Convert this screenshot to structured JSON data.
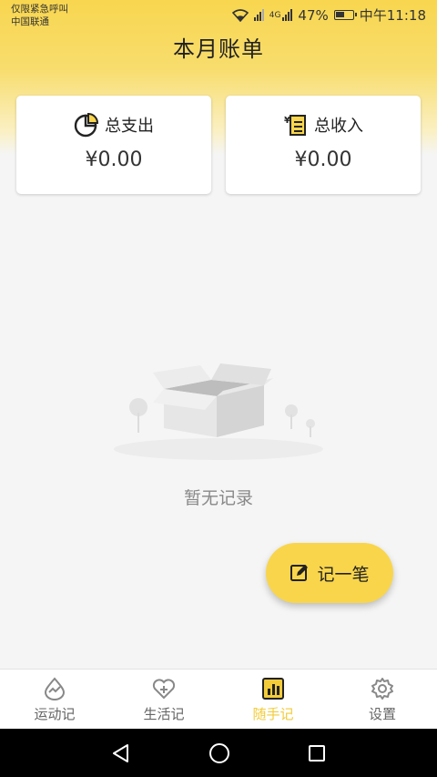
{
  "status_bar": {
    "carrier_line1": "仅限紧急呼叫",
    "carrier_line2": "中国联通",
    "battery_percent": "47%",
    "time": "中午11:18",
    "network": "4G"
  },
  "header": {
    "title": "本月账单"
  },
  "summary": {
    "expense": {
      "label": "总支出",
      "amount": "¥0.00"
    },
    "income": {
      "label": "总收入",
      "amount": "¥0.00"
    }
  },
  "empty_state": {
    "text": "暂无记录"
  },
  "fab": {
    "label": "记一笔"
  },
  "bottom_nav": {
    "items": [
      {
        "label": "运动记",
        "icon": "sport-icon"
      },
      {
        "label": "生活记",
        "icon": "heart-plus-icon"
      },
      {
        "label": "随手记",
        "icon": "bar-chart-icon",
        "active": true
      },
      {
        "label": "设置",
        "icon": "gear-icon"
      }
    ]
  },
  "colors": {
    "accent": "#f9d54c",
    "active_nav": "#f2cc3a"
  }
}
